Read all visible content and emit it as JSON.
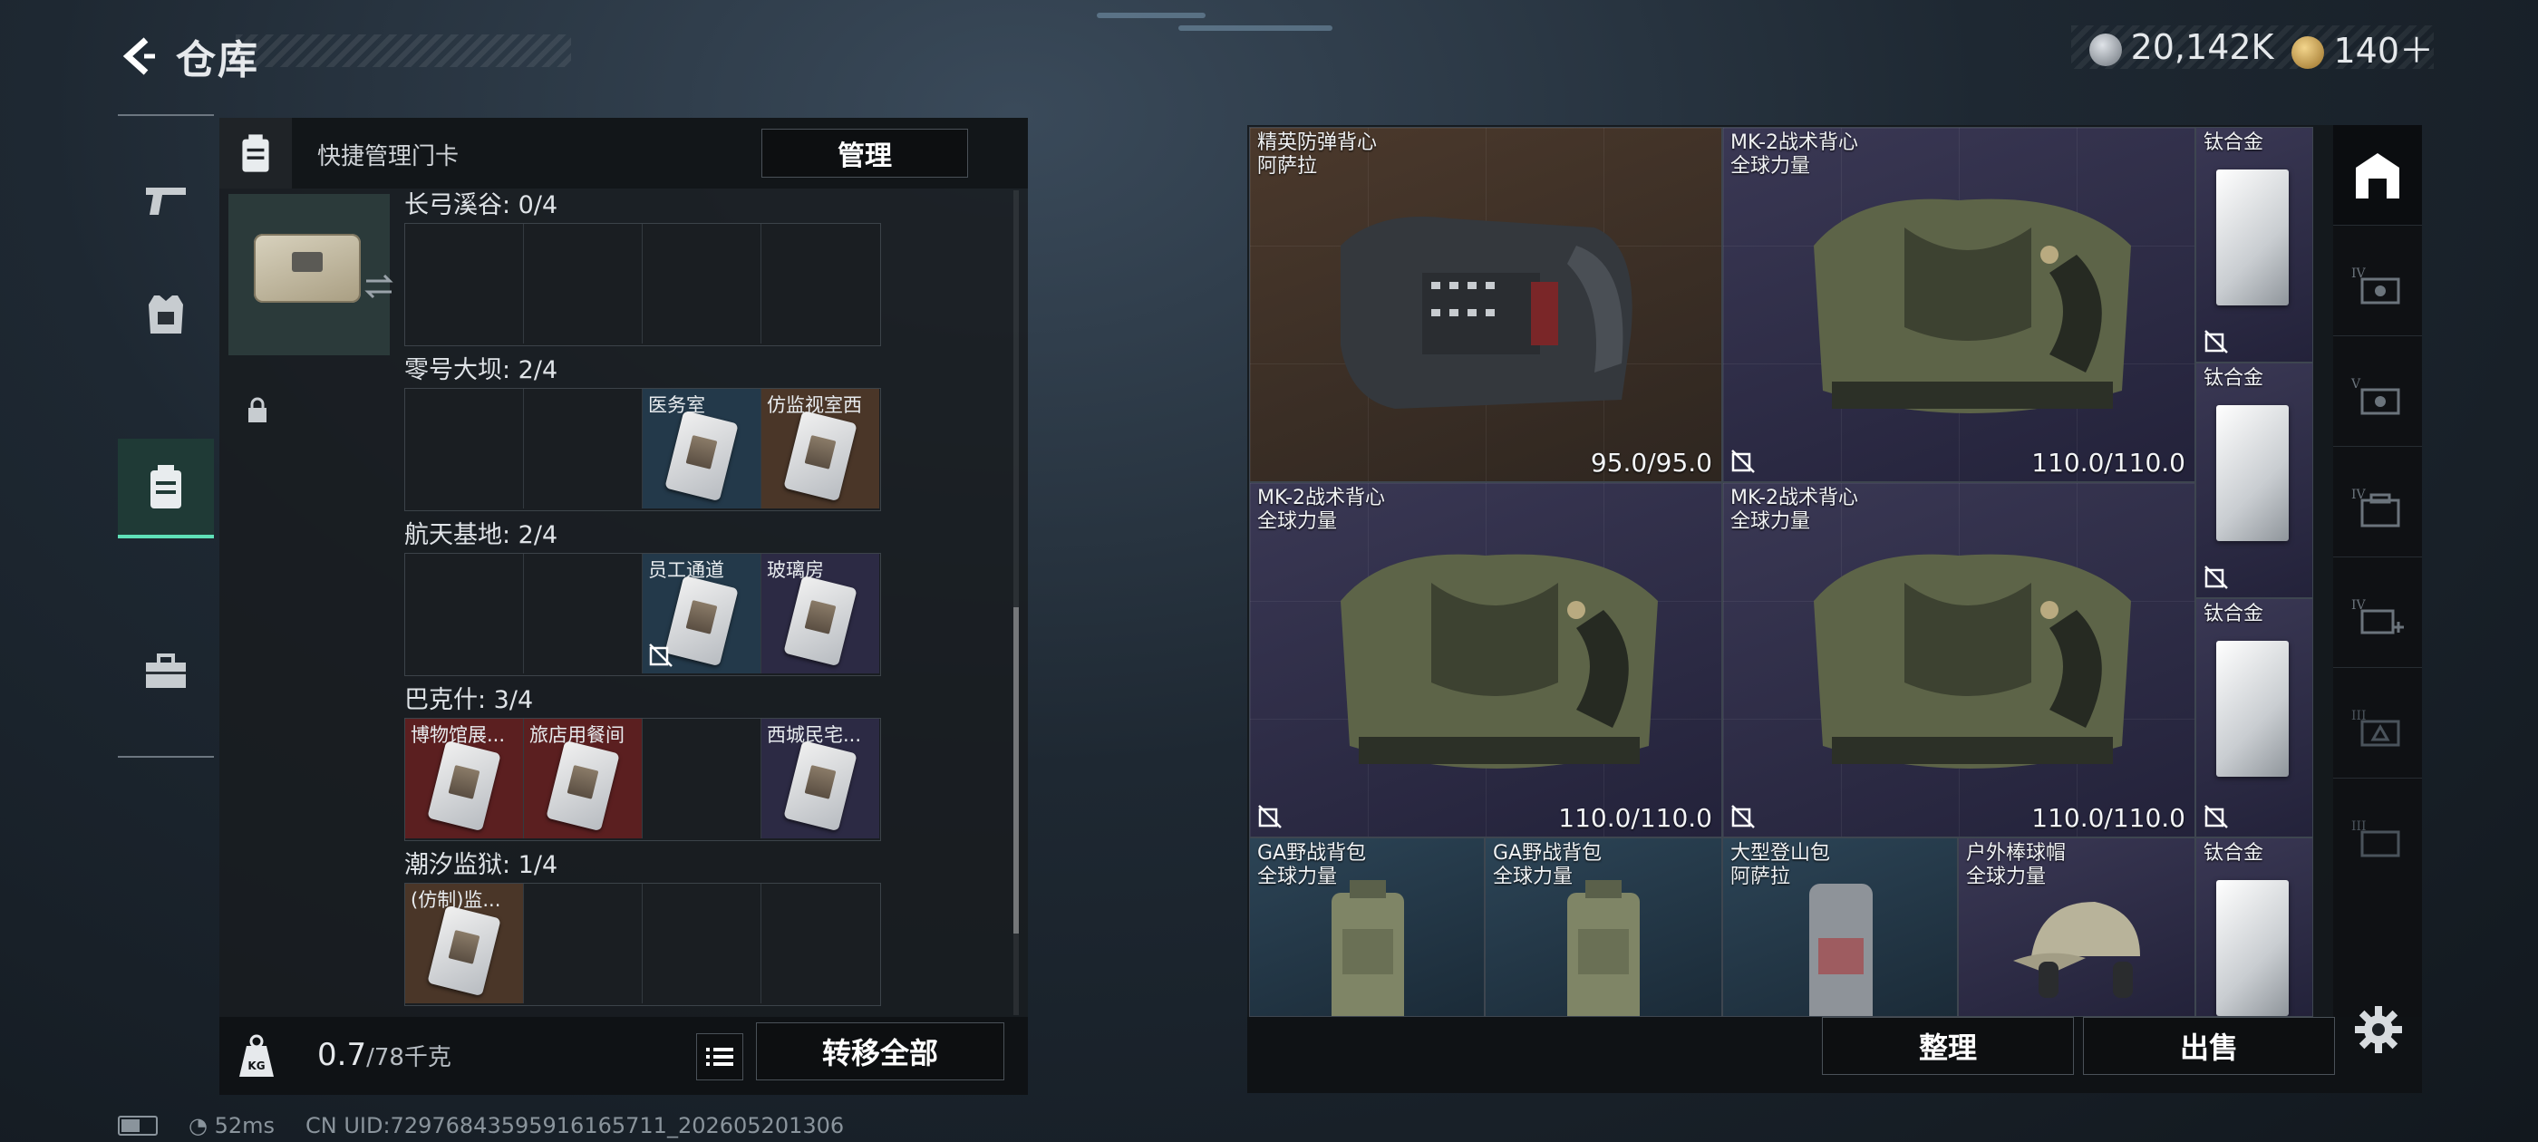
{
  "header": {
    "title": "仓库",
    "back_icon": "back-arrow-icon"
  },
  "currency": {
    "silver": "20,142K",
    "gold": "140＋"
  },
  "left_rail": [
    {
      "icon": "pistol-icon",
      "active": false
    },
    {
      "icon": "armor-icon",
      "active": false
    },
    {
      "icon": "keycard-case-icon",
      "active": true
    },
    {
      "icon": "toolbox-icon",
      "active": false
    }
  ],
  "keycard_panel": {
    "header_label": "快捷管理门卡",
    "manage_button": "管理",
    "groups": [
      {
        "label": "长弓溪谷: 0/4",
        "cells": [
          {
            "label": ""
          },
          {
            "label": ""
          },
          {
            "label": ""
          },
          {
            "label": ""
          }
        ]
      },
      {
        "label": "零号大坝: 2/4",
        "cells": [
          {
            "label": ""
          },
          {
            "label": ""
          },
          {
            "label": "医务室",
            "color": "blue"
          },
          {
            "label": "仿监视室西",
            "color": "brown"
          }
        ]
      },
      {
        "label": "航天基地: 2/4",
        "cells": [
          {
            "label": ""
          },
          {
            "label": ""
          },
          {
            "label": "员工通道",
            "color": "blue",
            "no_trade": true
          },
          {
            "label": "玻璃房",
            "color": "purple"
          }
        ]
      },
      {
        "label": "巴克什: 3/4",
        "cells": [
          {
            "label": "博物馆展...",
            "color": "red"
          },
          {
            "label": "旅店用餐间",
            "color": "red"
          },
          {
            "label": ""
          },
          {
            "label": "西城民宅...",
            "color": "purple"
          }
        ]
      },
      {
        "label": "潮汐监狱: 1/4",
        "cells": [
          {
            "label": "(仿制)监...",
            "color": "brown"
          },
          {
            "label": ""
          },
          {
            "label": ""
          },
          {
            "label": ""
          }
        ]
      }
    ],
    "weight_value": "0.7",
    "weight_max": "/78千克",
    "transfer_all_button": "转移全部"
  },
  "inventory": {
    "items": [
      {
        "name": "精英防弹背心\n阿萨拉",
        "durability": "95.0/95.0",
        "color": "brown"
      },
      {
        "name": "MK-2战术背心\n全球力量",
        "durability": "110.0/110.0",
        "color": "purple"
      },
      {
        "name": "钛合金",
        "color": "purple"
      },
      {
        "name": "钛合金",
        "color": "purple"
      },
      {
        "name": "MK-2战术背心\n全球力量",
        "durability": "110.0/110.0",
        "color": "purple"
      },
      {
        "name": "MK-2战术背心\n全球力量",
        "durability": "110.0/110.0",
        "color": "purple"
      },
      {
        "name": "钛合金",
        "color": "purple"
      },
      {
        "name": "GA野战背包\n全球力量",
        "color": "blue"
      },
      {
        "name": "GA野战背包\n全球力量",
        "color": "blue"
      },
      {
        "name": "大型登山包\n阿萨拉",
        "color": "blue"
      },
      {
        "name": "户外棒球帽\n全球力量",
        "color": "purple"
      },
      {
        "name": "钛合金",
        "color": "purple"
      }
    ],
    "sort_button": "整理",
    "sell_button": "出售"
  },
  "right_rail": [
    {
      "icon": "warehouse-icon",
      "active": true
    },
    {
      "icon": "armor-tier-iv-icon"
    },
    {
      "icon": "armor-tier-v-icon"
    },
    {
      "icon": "case-tier-iv-icon"
    },
    {
      "icon": "medkit-tier-iv-icon"
    },
    {
      "icon": "tier-iii-icon"
    },
    {
      "icon": "tier-iii-box-icon"
    }
  ],
  "status_bar": {
    "ping": "52ms",
    "uid": "CN UID:7297684359591616571​1_202605201306"
  }
}
